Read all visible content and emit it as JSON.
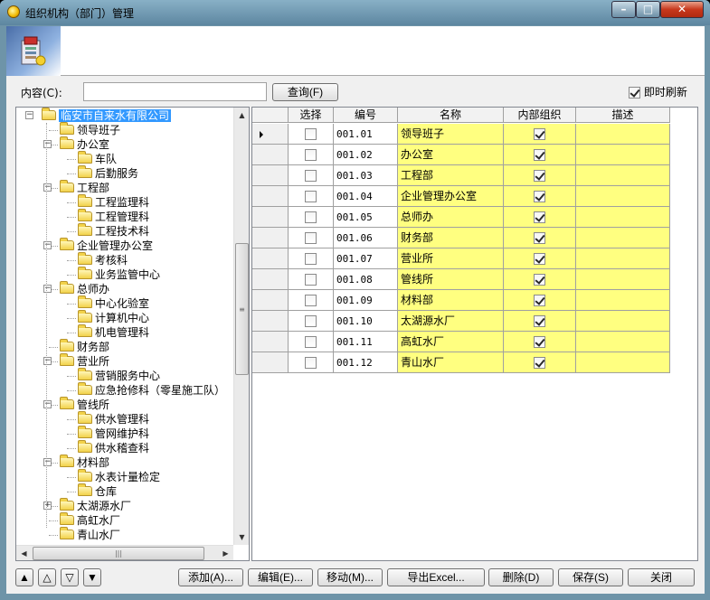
{
  "window": {
    "title": "组织机构（部门）管理"
  },
  "search": {
    "label": "内容(C):",
    "value": "",
    "button": "查询(F)"
  },
  "auto_refresh": {
    "label": "即时刷新",
    "checked": true
  },
  "tree": {
    "items": [
      {
        "label": "临安市自来水有限公司",
        "selected": true,
        "expander": "-"
      },
      {
        "label": "领导班子"
      },
      {
        "label": "办公室",
        "expander": "-"
      },
      {
        "label": "车队"
      },
      {
        "label": "后勤服务"
      },
      {
        "label": "工程部",
        "expander": "-"
      },
      {
        "label": "工程监理科"
      },
      {
        "label": "工程管理科"
      },
      {
        "label": "工程技术科"
      },
      {
        "label": "企业管理办公室",
        "expander": "-"
      },
      {
        "label": "考核科"
      },
      {
        "label": "业务监管中心"
      },
      {
        "label": "总师办",
        "expander": "-"
      },
      {
        "label": "中心化验室"
      },
      {
        "label": "计算机中心"
      },
      {
        "label": "机电管理科"
      },
      {
        "label": "财务部"
      },
      {
        "label": "营业所",
        "expander": "-"
      },
      {
        "label": "营销服务中心"
      },
      {
        "label": "应急抢修科（零星施工队）"
      },
      {
        "label": "管线所",
        "expander": "-"
      },
      {
        "label": "供水管理科"
      },
      {
        "label": "管网维护科"
      },
      {
        "label": "供水稽查科"
      },
      {
        "label": "材料部",
        "expander": "-"
      },
      {
        "label": "水表计量检定"
      },
      {
        "label": "仓库"
      },
      {
        "label": "太湖源水厂",
        "expander": "+"
      },
      {
        "label": "高虹水厂"
      },
      {
        "label": "青山水厂"
      }
    ]
  },
  "grid": {
    "columns": [
      "选择",
      "编号",
      "名称",
      "内部组织",
      "描述"
    ],
    "rows": [
      {
        "select": false,
        "code": "001.01",
        "name": "领导班子",
        "internal": true,
        "desc": ""
      },
      {
        "select": false,
        "code": "001.02",
        "name": "办公室",
        "internal": true,
        "desc": ""
      },
      {
        "select": false,
        "code": "001.03",
        "name": "工程部",
        "internal": true,
        "desc": ""
      },
      {
        "select": false,
        "code": "001.04",
        "name": "企业管理办公室",
        "internal": true,
        "desc": ""
      },
      {
        "select": false,
        "code": "001.05",
        "name": "总师办",
        "internal": true,
        "desc": ""
      },
      {
        "select": false,
        "code": "001.06",
        "name": "财务部",
        "internal": true,
        "desc": ""
      },
      {
        "select": false,
        "code": "001.07",
        "name": "营业所",
        "internal": true,
        "desc": ""
      },
      {
        "select": false,
        "code": "001.08",
        "name": "管线所",
        "internal": true,
        "desc": ""
      },
      {
        "select": false,
        "code": "001.09",
        "name": "材料部",
        "internal": true,
        "desc": ""
      },
      {
        "select": false,
        "code": "001.10",
        "name": "太湖源水厂",
        "internal": true,
        "desc": ""
      },
      {
        "select": false,
        "code": "001.11",
        "name": "高虹水厂",
        "internal": true,
        "desc": ""
      },
      {
        "select": false,
        "code": "001.12",
        "name": "青山水厂",
        "internal": true,
        "desc": ""
      }
    ]
  },
  "nav_buttons": [
    "▲",
    "△",
    "▽",
    "▼"
  ],
  "actions": {
    "add": "添加(A)...",
    "edit": "编辑(E)...",
    "move": "移动(M)...",
    "export": "导出Excel...",
    "delete": "删除(D)",
    "save": "保存(S)",
    "close": "关闭"
  },
  "colors": {
    "grid_fill": "#ffff80",
    "selection": "#3399ff",
    "titlebar": "#6e94a8"
  }
}
